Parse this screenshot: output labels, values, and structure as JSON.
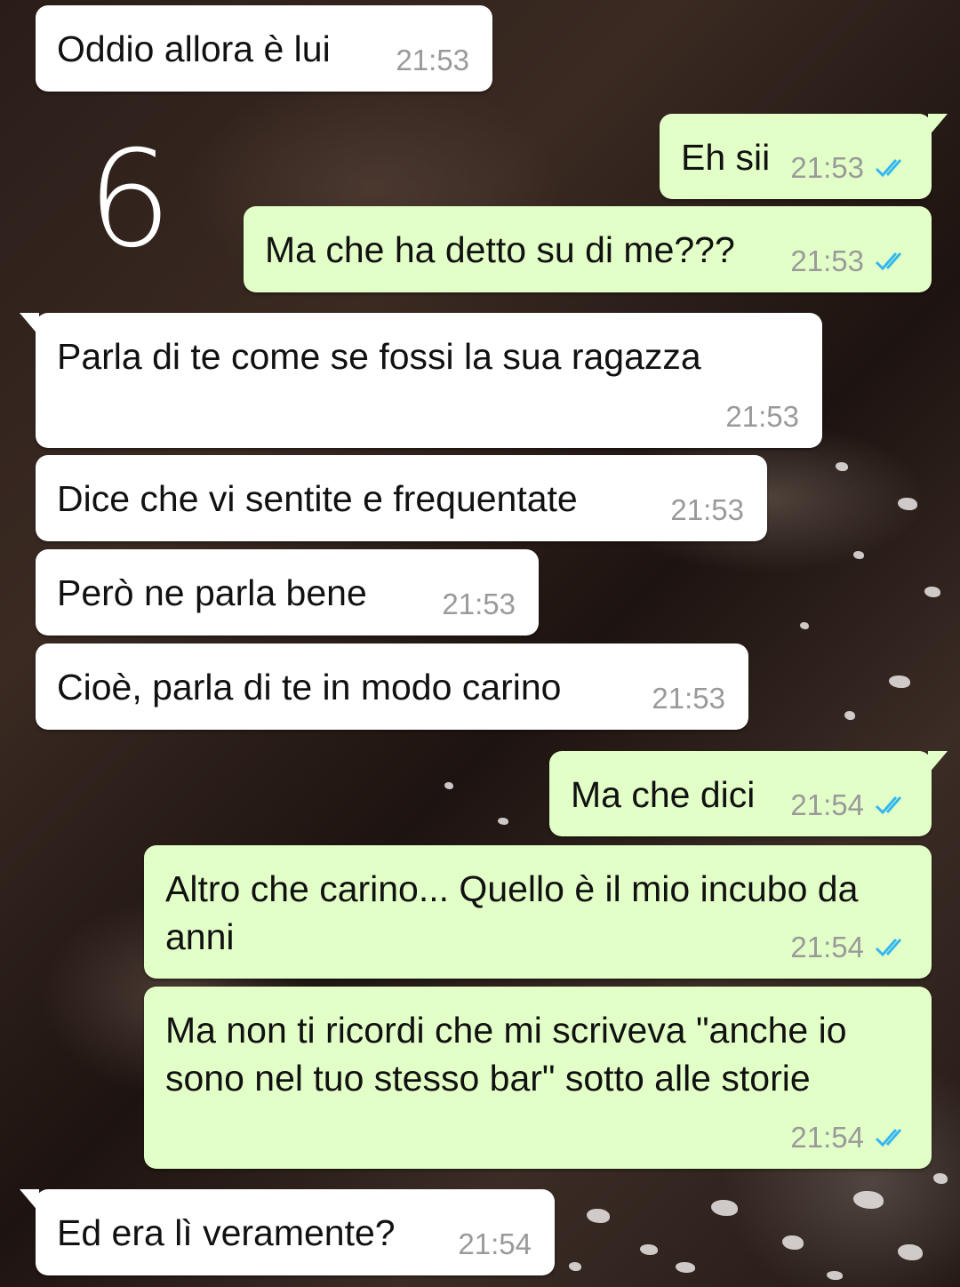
{
  "annotation": {
    "number": "6"
  },
  "colors": {
    "incoming_bubble": "#ffffff",
    "outgoing_bubble": "#e2ffc7",
    "read_ticks": "#34b7f1",
    "timestamp": "#9a9a9a"
  },
  "messages": [
    {
      "direction": "in",
      "text": "Oddio allora è lui",
      "time": "21:53"
    },
    {
      "direction": "out",
      "text": "Eh sii",
      "time": "21:53",
      "status": "read-double-check-icon"
    },
    {
      "direction": "out",
      "text": "Ma che ha detto su di me???",
      "time": "21:53",
      "status": "read-double-check-icon"
    },
    {
      "direction": "in",
      "text": "Parla di te come se fossi la sua ragazza",
      "time": "21:53"
    },
    {
      "direction": "in",
      "text": "Dice che vi sentite e frequentate",
      "time": "21:53"
    },
    {
      "direction": "in",
      "text": "Però ne parla bene",
      "time": "21:53"
    },
    {
      "direction": "in",
      "text": "Cioè, parla di te in modo carino",
      "time": "21:53"
    },
    {
      "direction": "out",
      "text": "Ma che dici",
      "time": "21:54",
      "status": "read-double-check-icon"
    },
    {
      "direction": "out",
      "text": "Altro che carino... Quello è il mio incubo da anni",
      "time": "21:54",
      "status": "read-double-check-icon"
    },
    {
      "direction": "out",
      "text": "Ma non ti ricordi che mi scriveva \"anche io sono nel tuo stesso bar\" sotto alle storie",
      "time": "21:54",
      "status": "read-double-check-icon"
    },
    {
      "direction": "in",
      "text": "Ed era lì veramente?",
      "time": "21:54"
    }
  ]
}
